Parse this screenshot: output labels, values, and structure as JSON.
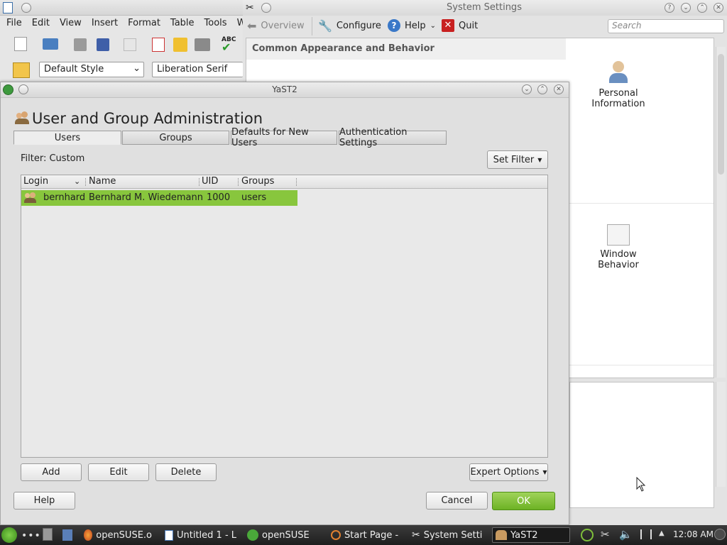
{
  "writer": {
    "menu": [
      "File",
      "Edit",
      "View",
      "Insert",
      "Format",
      "Table",
      "Tools",
      "Windo"
    ],
    "style_combo": "Default Style",
    "font_combo": "Liberation Serif"
  },
  "system_settings": {
    "title": "System Settings",
    "toolbar": {
      "overview": "Overview",
      "configure": "Configure",
      "help": "Help",
      "quit": "Quit"
    },
    "search_placeholder": "Search",
    "section_header": "Common Appearance and Behavior",
    "items": {
      "personal_information": "Personal\nInformation",
      "window_behavior": "Window\nBehavior"
    }
  },
  "yast": {
    "window_title": "YaST2",
    "heading": "User and Group Administration",
    "tabs": [
      "Users",
      "Groups",
      "Defaults for New Users",
      "Authentication Settings"
    ],
    "filter_label": "Filter: Custom",
    "set_filter": "Set Filter",
    "columns": [
      "Login",
      "Name",
      "UID",
      "Groups"
    ],
    "rows": [
      {
        "login": "bernhard",
        "name": "Bernhard M. Wiedemann",
        "uid": "1000",
        "groups": "users"
      }
    ],
    "buttons": {
      "add": "Add",
      "edit": "Edit",
      "delete": "Delete",
      "expert_options": "Expert Options",
      "help": "Help",
      "cancel": "Cancel",
      "ok": "OK"
    }
  },
  "taskbar": {
    "tasks": [
      "openSUSE.o",
      "Untitled 1 - L",
      "openSUSE",
      "Start Page -",
      "System Setti",
      "YaST2"
    ],
    "clock": "12:08 AM"
  },
  "colors": {
    "selection_green": "#88c63d",
    "ok_green": "#6db224",
    "taskbar_dark": "#2a2a2a"
  }
}
